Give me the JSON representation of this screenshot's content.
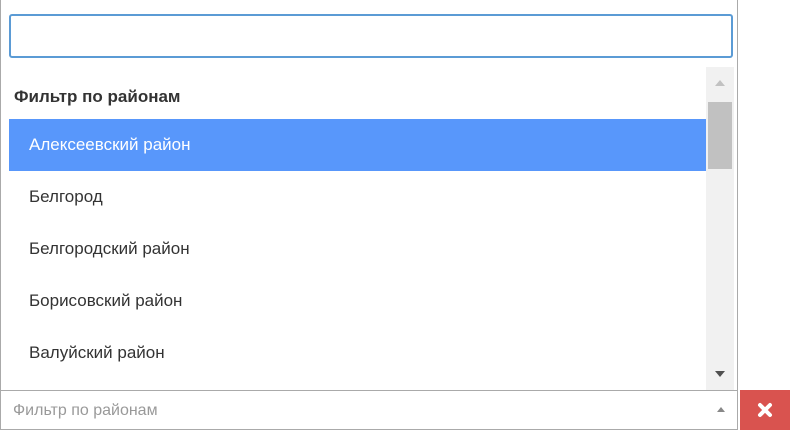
{
  "search": {
    "value": "",
    "placeholder": ""
  },
  "results": {
    "group_label": "Фильтр по районам",
    "options": [
      {
        "label": "Алексеевский район",
        "highlighted": true
      },
      {
        "label": "Белгород",
        "highlighted": false
      },
      {
        "label": "Белгородский район",
        "highlighted": false
      },
      {
        "label": "Борисовский район",
        "highlighted": false
      },
      {
        "label": "Валуйский район",
        "highlighted": false
      }
    ]
  },
  "select": {
    "placeholder": "Фильтр по районам",
    "arrow_icon": "caret-up-icon"
  },
  "clear_button": {
    "icon": "close-icon",
    "color": "#d9534f"
  },
  "colors": {
    "highlight": "#5897fb",
    "search_border": "#5b9bd5"
  }
}
